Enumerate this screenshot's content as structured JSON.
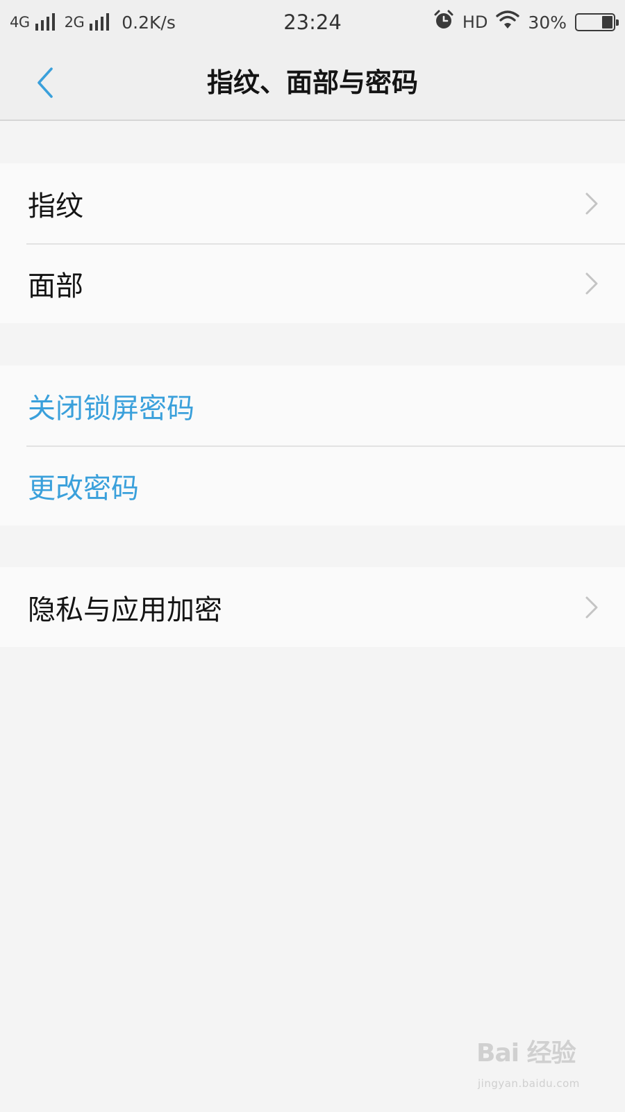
{
  "status_bar": {
    "network_1": "4G",
    "network_2": "2G",
    "speed": "0.2K/s",
    "time": "23:24",
    "hd": "HD",
    "battery_text": "30%",
    "battery_level": 0.3,
    "icons": [
      "signal-icon",
      "alarm-icon",
      "wifi-icon",
      "battery-icon"
    ]
  },
  "nav": {
    "title": "指纹、面部与密码",
    "back_icon": "chevron-left-icon"
  },
  "groups": {
    "biometrics": {
      "items": [
        {
          "label": "指纹"
        },
        {
          "label": "面部"
        }
      ]
    },
    "password": {
      "items": [
        {
          "label": "关闭锁屏密码"
        },
        {
          "label": "更改密码"
        }
      ]
    },
    "privacy": {
      "items": [
        {
          "label": "隐私与应用加密"
        }
      ]
    }
  },
  "colors": {
    "accent": "#3aa0db",
    "background": "#f4f4f4",
    "row_background": "#fafafa",
    "divider": "#e2e2e2"
  },
  "watermark": {
    "logo": "Bai 经验",
    "url": "jingyan.baidu.com"
  }
}
